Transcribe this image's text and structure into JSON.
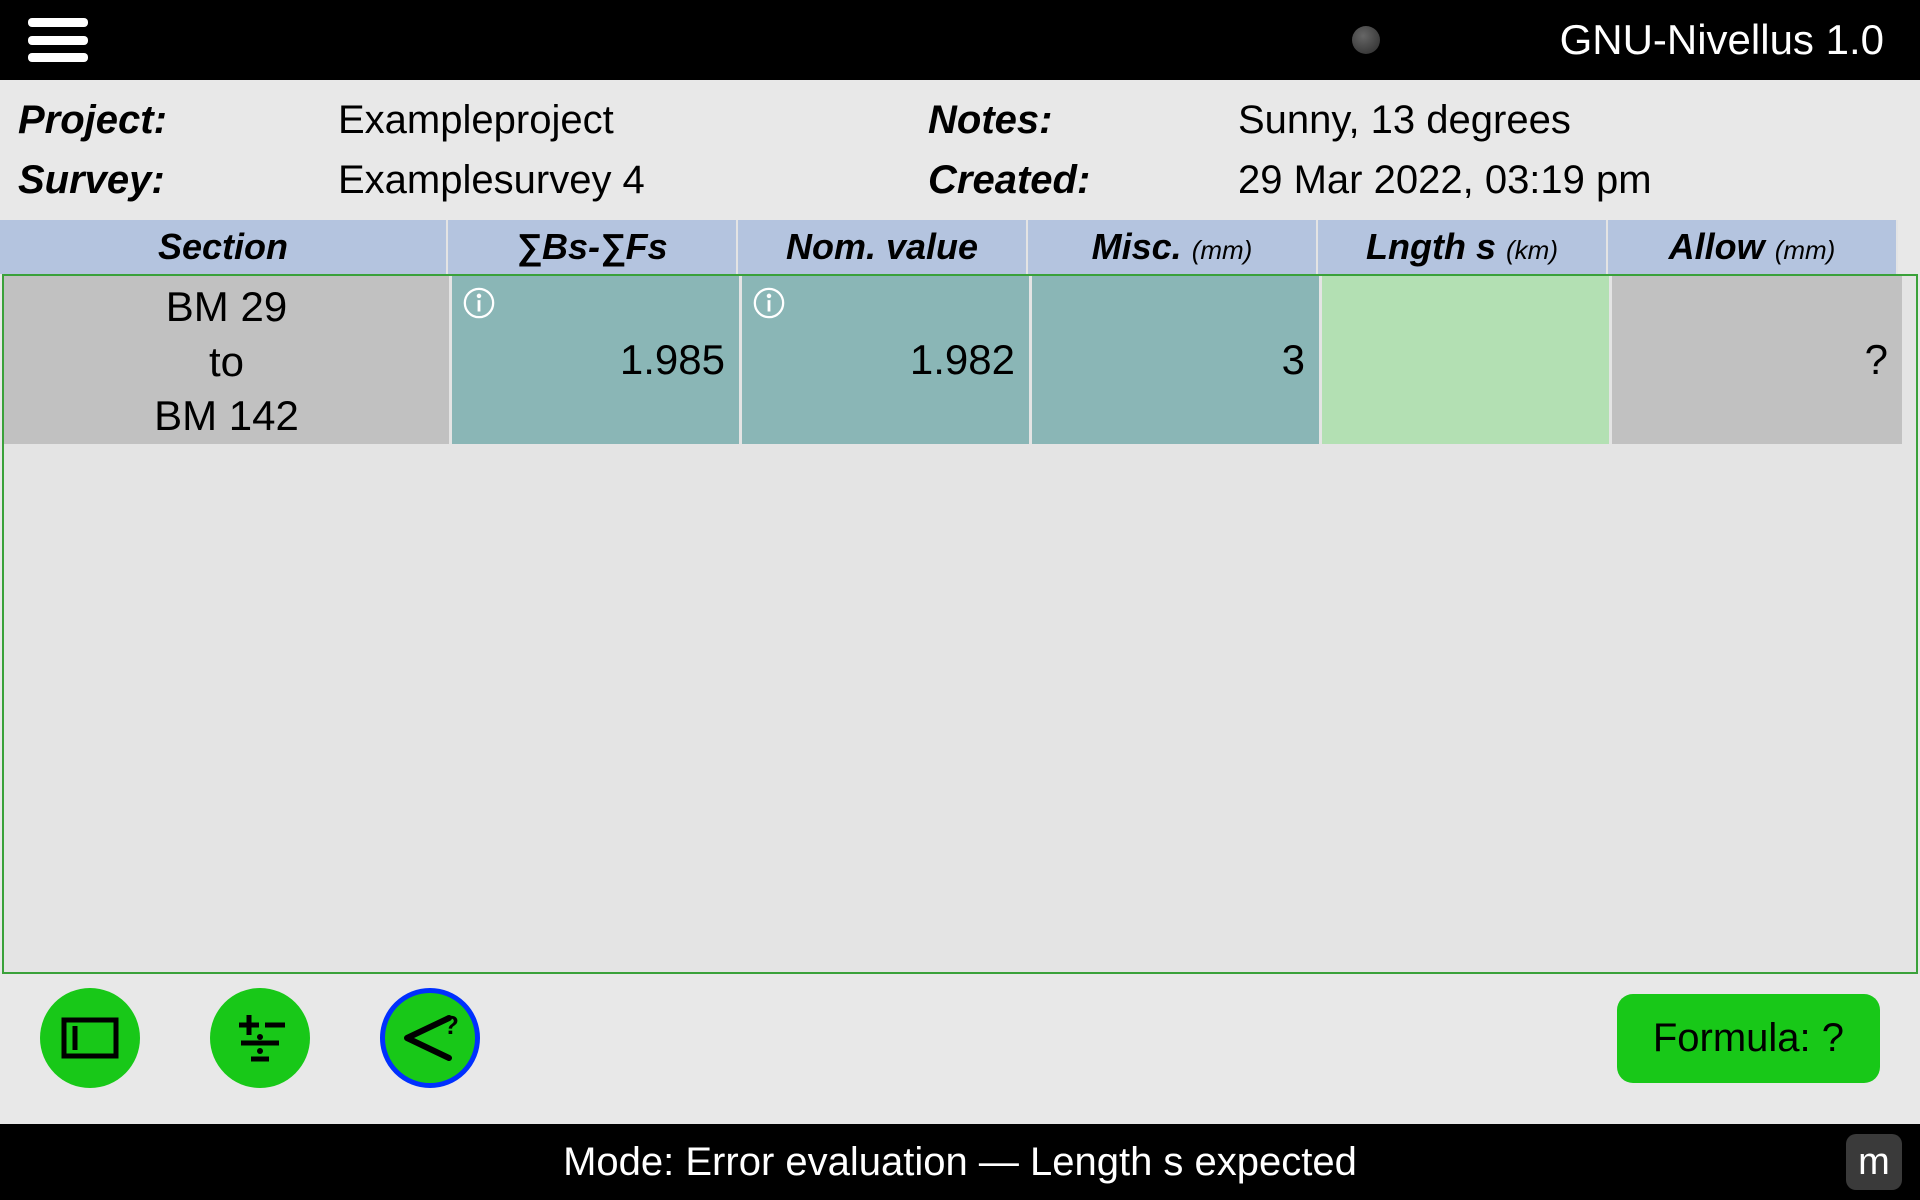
{
  "app_title": "GNU-Nivellus 1.0",
  "info": {
    "project_label": "Project:",
    "project_value": "Exampleproject",
    "survey_label": "Survey:",
    "survey_value": "Examplesurvey 4",
    "notes_label": "Notes:",
    "notes_value": "Sunny, 13 degrees",
    "created_label": "Created:",
    "created_value": "29 Mar 2022, 03:19 pm"
  },
  "headers": {
    "section": "Section",
    "bs_fs": "∑Bs-∑Fs",
    "nom": "Nom. value",
    "misc": "Misc.",
    "misc_unit": "(mm)",
    "length": "Lngth s",
    "length_unit": "(km)",
    "allow": "Allow",
    "allow_unit": "(mm)"
  },
  "row": {
    "section_top": "BM 29",
    "section_mid": "to",
    "section_bot": "BM 142",
    "bs_fs": "1.985",
    "nom": "1.982",
    "misc": "3",
    "length": "",
    "allow": "?"
  },
  "formula_button": "Formula: ?",
  "status": "Mode: Error evaluation — Length s expected",
  "unit_toggle": "m"
}
